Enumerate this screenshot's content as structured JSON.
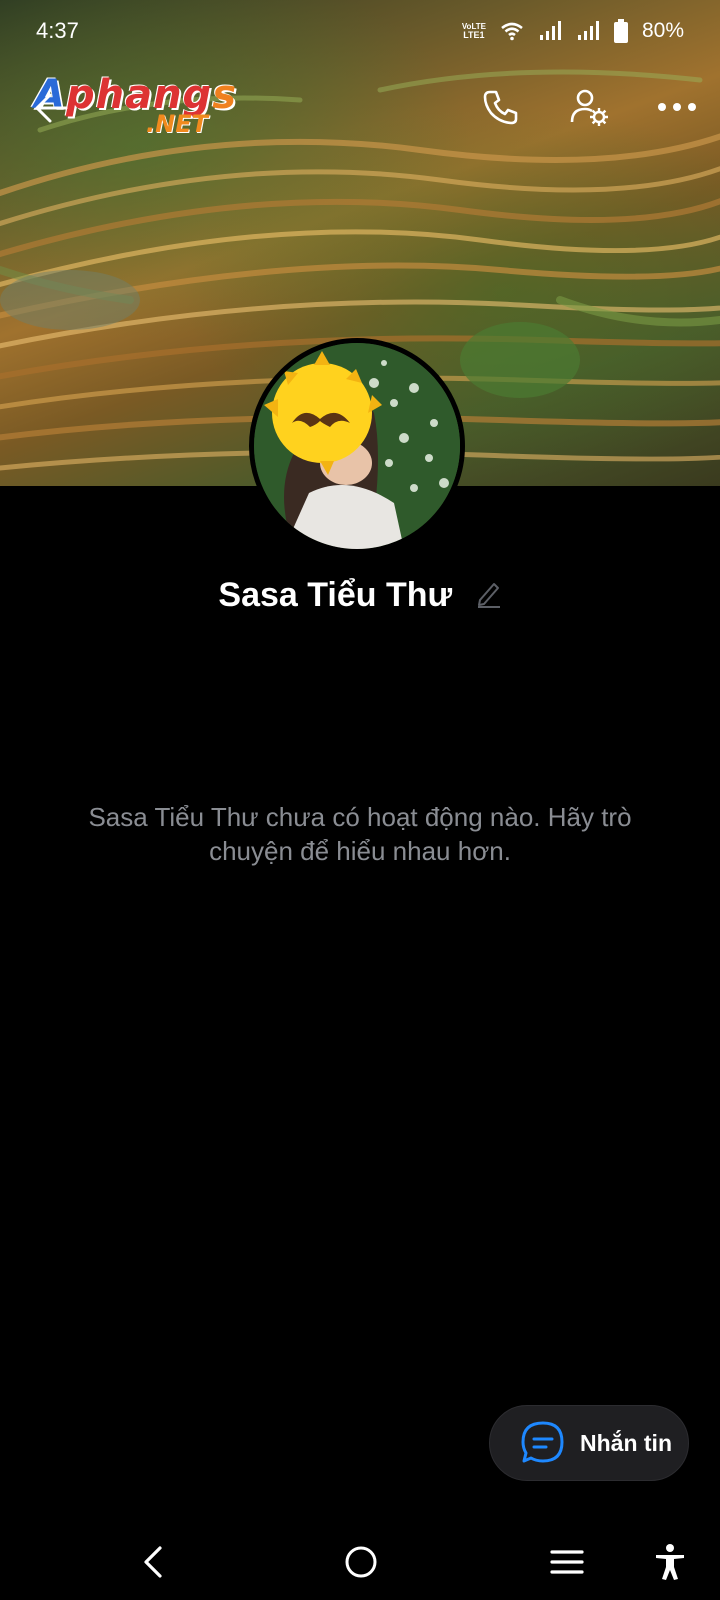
{
  "status_bar": {
    "time": "4:37",
    "volte_line1": "VoLTE",
    "volte_line2": "LTE1",
    "battery": "80%"
  },
  "watermark": {
    "top_a": "A",
    "top_rest": "phang",
    "top_s": "s",
    "bottom": ".NET"
  },
  "icons": {
    "back": "arrow-left-icon",
    "call": "phone-icon",
    "settings": "user-settings-icon",
    "more": "more-horizontal-icon",
    "edit": "pencil-icon",
    "chat": "chat-bubble-icon"
  },
  "profile": {
    "name": "Sasa Tiểu Thư"
  },
  "empty_state": {
    "message": "Sasa Tiểu Thư chưa có hoạt động nào. Hãy trò chuyện để hiểu nhau hơn."
  },
  "actions": {
    "message_label": "Nhắn tin"
  },
  "colors": {
    "background": "#000000",
    "accent": "#1e88ff",
    "muted_text": "#8a8d93",
    "button_bg": "#1f1f22"
  }
}
